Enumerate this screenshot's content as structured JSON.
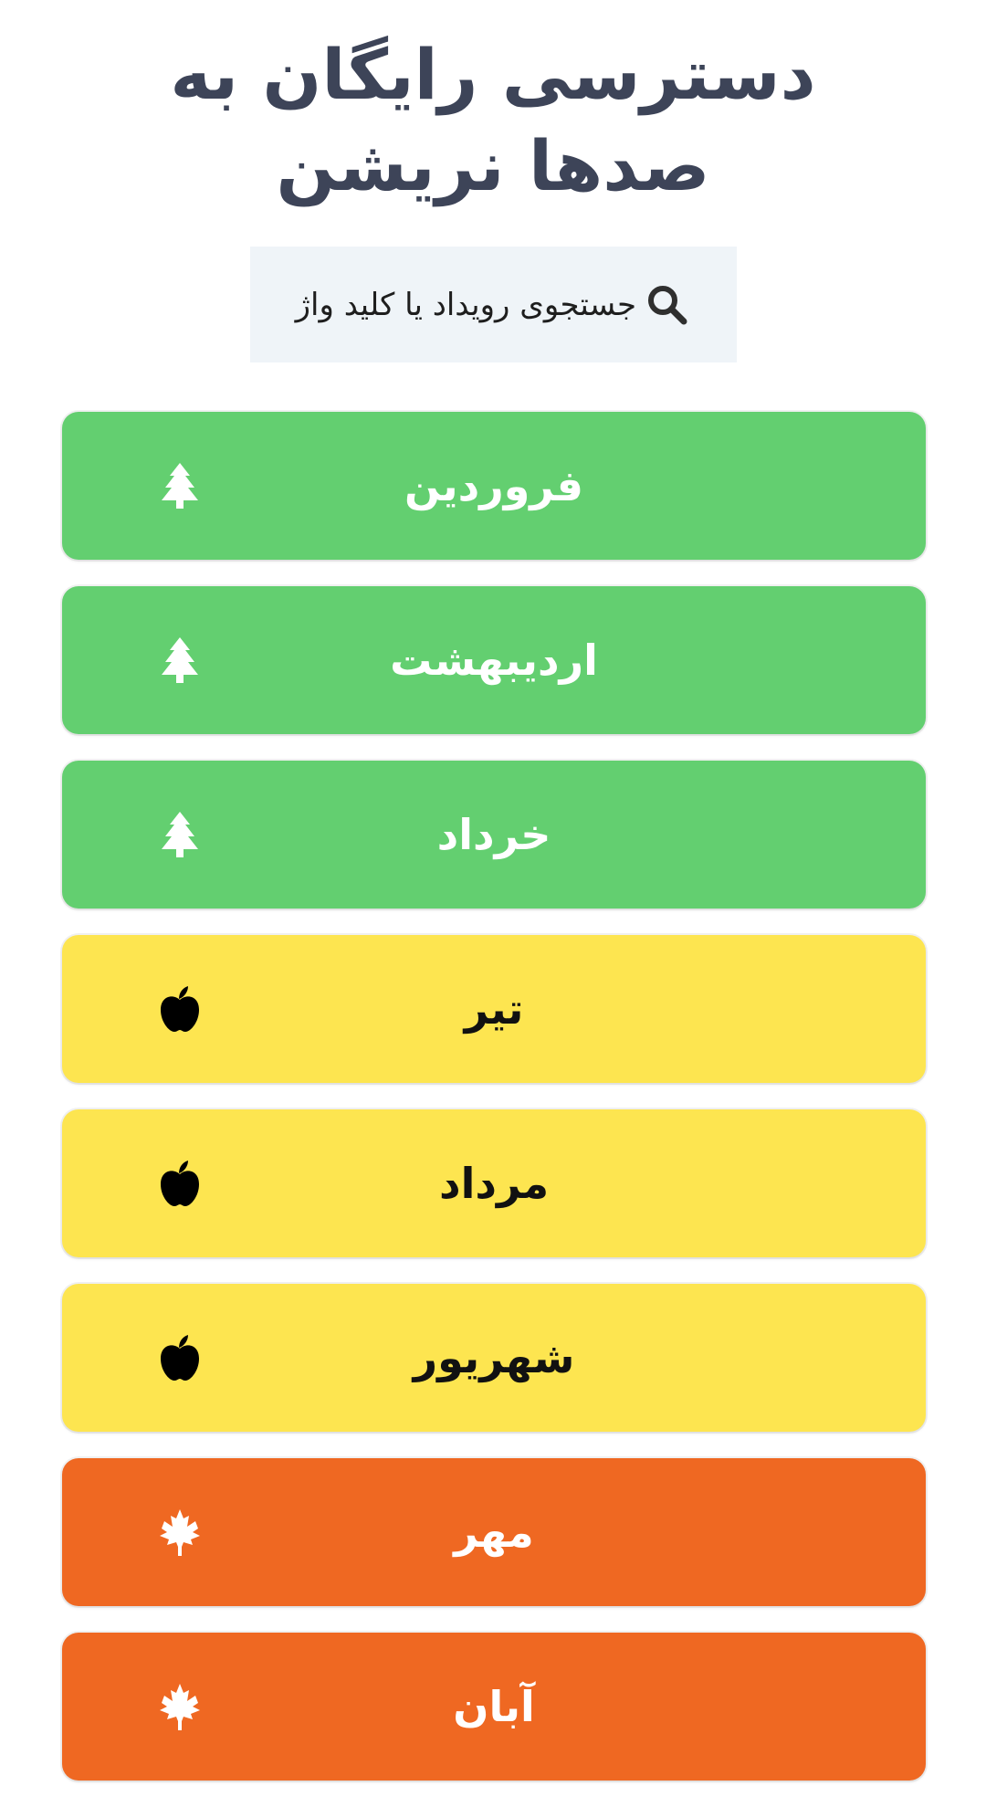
{
  "header": {
    "title": "دسترسی رایگان به صدها نریشن"
  },
  "search": {
    "label": "جستجوی رویداد یا کلید واژ",
    "icon": "search-icon"
  },
  "colors": {
    "spring": "#63cf70",
    "summer": "#fde550",
    "autumn": "#ef6822",
    "title": "#3d4458",
    "search_bg": "#eff4f8"
  },
  "months": [
    {
      "label": "فروردین",
      "season": "spring",
      "icon": "tree-icon"
    },
    {
      "label": "اردیبهشت",
      "season": "spring",
      "icon": "tree-icon"
    },
    {
      "label": "خرداد",
      "season": "spring",
      "icon": "tree-icon"
    },
    {
      "label": "تیر",
      "season": "summer",
      "icon": "apple-icon"
    },
    {
      "label": "مرداد",
      "season": "summer",
      "icon": "apple-icon"
    },
    {
      "label": "شهریور",
      "season": "summer",
      "icon": "apple-icon"
    },
    {
      "label": "مهر",
      "season": "autumn",
      "icon": "maple-leaf-icon"
    },
    {
      "label": "آبان",
      "season": "autumn",
      "icon": "maple-leaf-icon"
    }
  ]
}
